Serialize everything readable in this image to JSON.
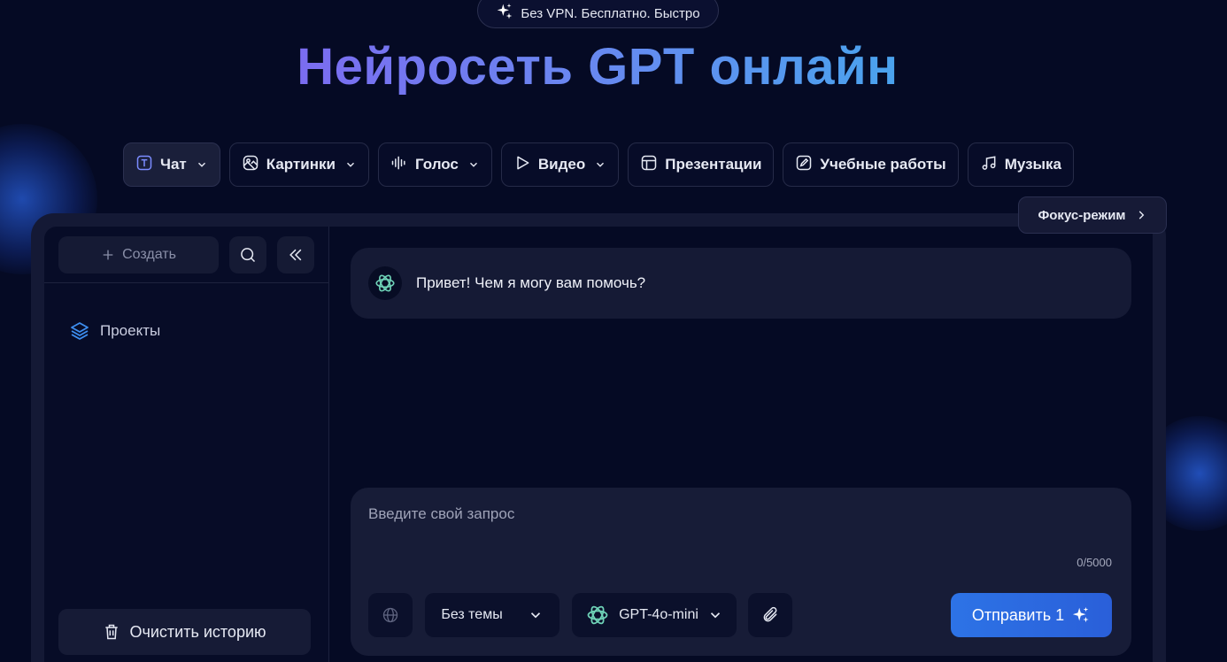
{
  "badge": {
    "text": "Без VPN. Бесплатно. Быстро",
    "icon": "sparkle-icon"
  },
  "hero": {
    "title": "Нейросеть GPT онлайн"
  },
  "tabs": [
    {
      "label": "Чат",
      "icon": "text-t-icon",
      "dropdown": true,
      "active": true
    },
    {
      "label": "Картинки",
      "icon": "image-icon",
      "dropdown": true
    },
    {
      "label": "Голос",
      "icon": "waveform-icon",
      "dropdown": true
    },
    {
      "label": "Видео",
      "icon": "play-icon",
      "dropdown": true
    },
    {
      "label": "Презентации",
      "icon": "presentation-icon",
      "dropdown": false
    },
    {
      "label": "Учебные работы",
      "icon": "edit-doc-icon",
      "dropdown": false
    },
    {
      "label": "Музыка",
      "icon": "music-icon",
      "dropdown": false
    }
  ],
  "focus": {
    "label": "Фокус-режим"
  },
  "sidebar": {
    "create_label": "Создать",
    "projects_label": "Проекты",
    "clear_label": "Очистить историю"
  },
  "chat": {
    "greeting": "Привет! Чем я могу вам помочь?",
    "input_placeholder": "Введите свой запрос",
    "counter": "0/5000",
    "topic_select": "Без темы",
    "model_select": "GPT-4o-mini",
    "send_label": "Отправить 1"
  },
  "colors": {
    "background": "#050a24",
    "accent": "#2d73e6",
    "title_gradient_start": "#7b6cf0",
    "title_gradient_end": "#4aa3ee"
  }
}
